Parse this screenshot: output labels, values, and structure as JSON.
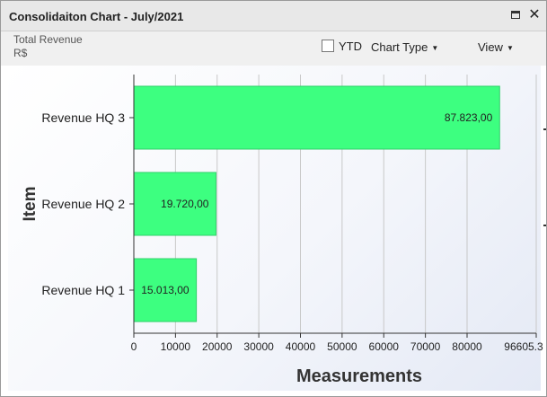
{
  "window": {
    "title": "Consolidaiton Chart - July/2021"
  },
  "toolbar": {
    "metric_name": "Total Revenue",
    "currency": "R$",
    "ytd_label": "YTD",
    "chart_type_label": "Chart Type",
    "view_label": "View"
  },
  "chart_data": {
    "type": "bar",
    "orientation": "horizontal",
    "categories": [
      "Revenue HQ 3",
      "Revenue HQ 2",
      "Revenue HQ 1"
    ],
    "values": [
      87823,
      19720,
      15013
    ],
    "data_labels": [
      "87.823,00",
      "19.720,00",
      "15.013,00"
    ],
    "xlabel": "Measurements",
    "ylabel": "Item",
    "xlim": [
      0,
      96605.3
    ],
    "xticks": [
      0,
      10000,
      20000,
      30000,
      40000,
      50000,
      60000,
      70000,
      80000,
      96605.3
    ],
    "xtick_labels": [
      "0",
      "10000",
      "20000",
      "30000",
      "40000",
      "50000",
      "60000",
      "70000",
      "80000",
      "96605.3"
    ],
    "grid": "vertical",
    "bar_color": "#3dff80"
  }
}
